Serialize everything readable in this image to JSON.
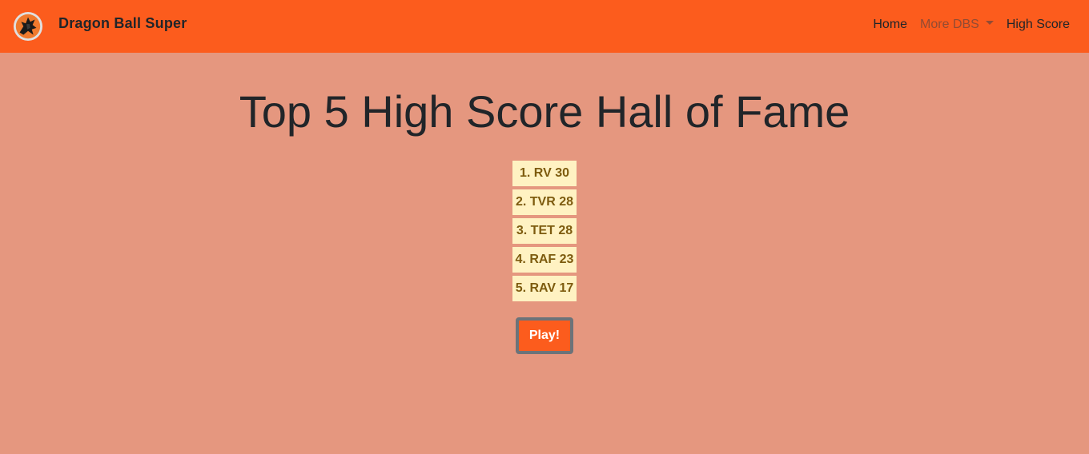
{
  "navbar": {
    "brand": "Dragon Ball Super",
    "logo_icon": "dragon-emblem-icon",
    "links": [
      {
        "label": "Home"
      },
      {
        "label": "More DBS"
      },
      {
        "label": "High Score"
      }
    ]
  },
  "main": {
    "title": "Top 5 High Score Hall of Fame",
    "scores": [
      "1. RV 30",
      "2. TVR 28",
      "3. TET 28",
      "4. RAF 23",
      "5. RAV 17"
    ],
    "play_label": "Play!"
  },
  "colors": {
    "navbar": "#fc5c1d",
    "page_background": "#e5977f",
    "score_background": "#fff2c2",
    "score_text": "#7d5b0e",
    "play_button": "#fc5c1d",
    "play_button_border": "#6c7379"
  }
}
